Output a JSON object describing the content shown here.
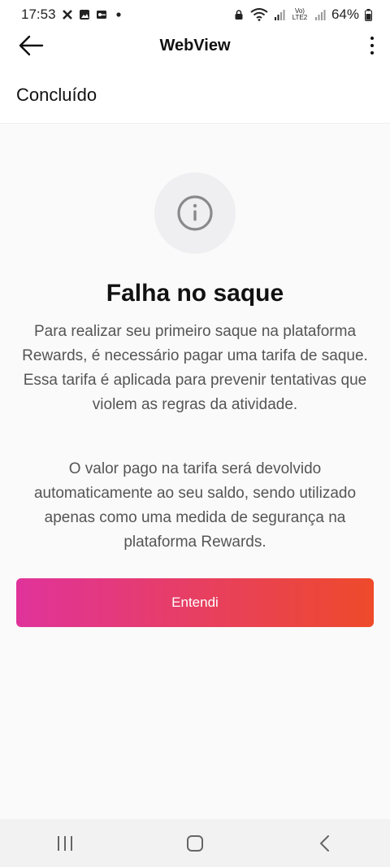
{
  "status_bar": {
    "time": "17:53",
    "battery": "64%",
    "icons": [
      "x-icon",
      "image-icon",
      "key-icon",
      "dot-icon",
      "lock-icon",
      "wifi-icon",
      "signal-icon",
      "volte-icon",
      "battery-icon"
    ],
    "volte_label": "Vo) LTE2"
  },
  "app_bar": {
    "title": "WebView",
    "back_icon": "back-arrow-icon",
    "menu_icon": "more-vert-icon"
  },
  "toolbar": {
    "done_label": "Concluído"
  },
  "dialog": {
    "icon": "info-icon",
    "title": "Falha no saque",
    "paragraph1": "Para realizar seu primeiro saque na plataforma Rewards, é necessário pagar uma tarifa de saque. Essa tarifa é aplicada para prevenir tentativas que violem as regras da atividade.",
    "paragraph2": "O valor pago na tarifa será devolvido automaticamente ao seu saldo, sendo utilizado apenas como uma medida de segurança na plataforma Rewards.",
    "button_label": "Entendi",
    "button_gradient": [
      "#e0339b",
      "#ee4a2a"
    ]
  },
  "nav_bar": {
    "buttons": [
      "recents-icon",
      "home-icon",
      "back-icon"
    ]
  }
}
